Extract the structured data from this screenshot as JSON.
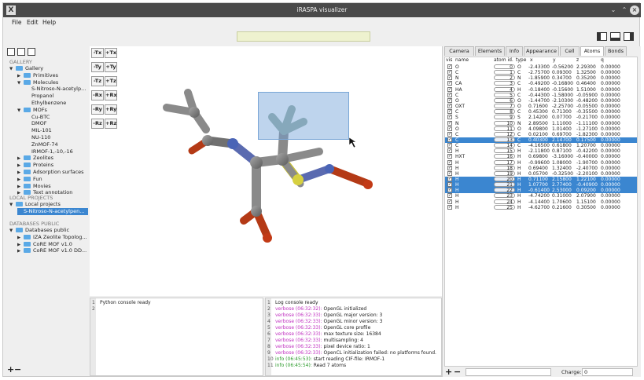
{
  "window": {
    "title": "iRASPA visualizer",
    "app_icon": "X"
  },
  "menu": {
    "file": "File",
    "edit": "Edit",
    "help": "Help"
  },
  "gallery": {
    "heading": "GALLERY",
    "items": [
      {
        "label": "Gallery",
        "depth": 0,
        "expanded": true,
        "folder": true
      },
      {
        "label": "Primitives",
        "depth": 1,
        "expanded": false,
        "folder": true
      },
      {
        "label": "Molecules",
        "depth": 1,
        "expanded": true,
        "folder": true
      },
      {
        "label": "S-Nitroso-N-acetylp...",
        "depth": 2,
        "folder": false
      },
      {
        "label": "Propanol",
        "depth": 2,
        "folder": false
      },
      {
        "label": "Ethylbenzene",
        "depth": 2,
        "folder": false
      },
      {
        "label": "MOFs",
        "depth": 1,
        "expanded": true,
        "folder": true
      },
      {
        "label": "Cu-BTC",
        "depth": 2,
        "folder": false
      },
      {
        "label": "DMOF",
        "depth": 2,
        "folder": false
      },
      {
        "label": "MIL-101",
        "depth": 2,
        "folder": false
      },
      {
        "label": "NU-110",
        "depth": 2,
        "folder": false
      },
      {
        "label": "ZnMOF-74",
        "depth": 2,
        "folder": false
      },
      {
        "label": "IRMOF-1,-10,-16",
        "depth": 2,
        "folder": false
      },
      {
        "label": "Zeolites",
        "depth": 1,
        "expanded": false,
        "folder": true
      },
      {
        "label": "Proteins",
        "depth": 1,
        "expanded": false,
        "folder": true
      },
      {
        "label": "Adsorption surfaces",
        "depth": 1,
        "expanded": false,
        "folder": true
      },
      {
        "label": "Fun",
        "depth": 1,
        "expanded": false,
        "folder": true
      },
      {
        "label": "Movies",
        "depth": 1,
        "expanded": false,
        "folder": true
      },
      {
        "label": "Text annotation",
        "depth": 1,
        "expanded": false,
        "folder": true
      }
    ]
  },
  "local_projects": {
    "heading": "LOCAL PROJECTS",
    "items": [
      {
        "label": "Local projects",
        "depth": 0,
        "expanded": true,
        "folder": true
      },
      {
        "label": "S-Nitroso-N-acetylpen...",
        "depth": 1,
        "folder": false,
        "selected": true
      }
    ]
  },
  "databases": {
    "heading": "DATABASES PUBLIC",
    "items": [
      {
        "label": "Databases public",
        "depth": 0,
        "expanded": true,
        "folder": true
      },
      {
        "label": "IZA Zeolite Topolog...",
        "depth": 1,
        "expanded": false,
        "folder": true
      },
      {
        "label": "CoRE MOF v1.0",
        "depth": 1,
        "expanded": false,
        "folder": true
      },
      {
        "label": "CoRE MOF v1.0 DD...",
        "depth": 1,
        "expanded": false,
        "folder": true
      }
    ]
  },
  "left_bottom": {
    "add": "+",
    "remove": "−"
  },
  "axis_buttons": [
    [
      "-Tx",
      "+Tx"
    ],
    [
      "-Ty",
      "+Ty"
    ],
    [
      "-Tz",
      "+Tz"
    ],
    [
      "-Rx",
      "+Rx"
    ],
    [
      "-Ry",
      "+Ry"
    ],
    [
      "-Rz",
      "+Rz"
    ]
  ],
  "python_console": {
    "lines": [
      {
        "num": "1",
        "text": "Python console ready"
      },
      {
        "num": "2",
        "text": ""
      }
    ]
  },
  "log_console": {
    "lines": [
      {
        "num": "1",
        "prefix": "",
        "text": "Log console ready",
        "kind": "plain"
      },
      {
        "num": "2",
        "prefix": "verbose (06:32:32):",
        "text": " OpenGL initialized",
        "kind": "verbose"
      },
      {
        "num": "3",
        "prefix": "verbose (06:32:33):",
        "text": " OpenGL major version: 3",
        "kind": "verbose"
      },
      {
        "num": "4",
        "prefix": "verbose (06:32:33):",
        "text": " OpenGL minor version: 3",
        "kind": "verbose"
      },
      {
        "num": "5",
        "prefix": "verbose (06:32:33):",
        "text": " OpenGL core profile",
        "kind": "verbose"
      },
      {
        "num": "6",
        "prefix": "verbose (06:32:33):",
        "text": " max texture size: 16384",
        "kind": "verbose"
      },
      {
        "num": "7",
        "prefix": "verbose (06:32:33):",
        "text": " multisampling: 4",
        "kind": "verbose"
      },
      {
        "num": "8",
        "prefix": "verbose (06:32:33):",
        "text": " pixel device ratio: 1",
        "kind": "verbose"
      },
      {
        "num": "9",
        "prefix": "verbose (06:32:33):",
        "text": " OpenCL initialization failed: no platforms found.",
        "kind": "verbose"
      },
      {
        "num": "10",
        "prefix": "info (06:45:53):",
        "text": " start reading CIF-file: IRMOF-1",
        "kind": "info"
      },
      {
        "num": "11",
        "prefix": "info (06:45:54):",
        "text": " Read 7 atoms",
        "kind": "info"
      }
    ]
  },
  "tabs": [
    "Camera",
    "Elements",
    "Info",
    "Appearance",
    "Cell",
    "Atoms",
    "Bonds"
  ],
  "active_tab": "Atoms",
  "atom_table": {
    "headers": {
      "vis": "vis",
      "name": "name",
      "atom_id": "atom id.",
      "type": "type",
      "x": "x",
      "y": "y",
      "z": "z",
      "q": "q"
    },
    "rows": [
      {
        "name": "O",
        "id": "0",
        "type": "O",
        "x": "-2.43300",
        "y": "-0.56200",
        "z": "2.29300",
        "q": "0.00000",
        "selected": false
      },
      {
        "name": "C",
        "id": "1",
        "type": "C",
        "x": "-2.75700",
        "y": "0.09300",
        "z": "1.32500",
        "q": "0.00000",
        "selected": false
      },
      {
        "name": "N",
        "id": "2",
        "type": "N",
        "x": "-1.85900",
        "y": "0.34700",
        "z": "0.35200",
        "q": "0.00000",
        "selected": false
      },
      {
        "name": "CA",
        "id": "3",
        "type": "C",
        "x": "-0.49200",
        "y": "-0.16800",
        "z": "0.46400",
        "q": "0.00000",
        "selected": false
      },
      {
        "name": "HA",
        "id": "4",
        "type": "H",
        "x": "-0.18400",
        "y": "-0.15600",
        "z": "1.51000",
        "q": "0.00000",
        "selected": false
      },
      {
        "name": "C",
        "id": "5",
        "type": "C",
        "x": "-0.44300",
        "y": "-1.58000",
        "z": "-0.05900",
        "q": "0.00000",
        "selected": false
      },
      {
        "name": "O",
        "id": "6",
        "type": "O",
        "x": "-1.44700",
        "y": "-2.10300",
        "z": "-0.48200",
        "q": "0.00000",
        "selected": false
      },
      {
        "name": "OXT",
        "id": "7",
        "type": "O",
        "x": "0.71600",
        "y": "-2.25700",
        "z": "-0.05500",
        "q": "0.00000",
        "selected": false
      },
      {
        "name": "C",
        "id": "8",
        "type": "C",
        "x": "0.45300",
        "y": "0.71300",
        "z": "-0.35500",
        "q": "0.00000",
        "selected": false
      },
      {
        "name": "S",
        "id": "9",
        "type": "S",
        "x": "2.14200",
        "y": "0.07700",
        "z": "-0.21700",
        "q": "0.00000",
        "selected": false
      },
      {
        "name": "N",
        "id": "10",
        "type": "N",
        "x": "2.89500",
        "y": "1.11000",
        "z": "-1.11100",
        "q": "0.00000",
        "selected": false
      },
      {
        "name": "O",
        "id": "11",
        "type": "O",
        "x": "4.09800",
        "y": "1.01400",
        "z": "-1.27100",
        "q": "0.00000",
        "selected": false
      },
      {
        "name": "C",
        "id": "12",
        "type": "C",
        "x": "0.02100",
        "y": "0.69700",
        "z": "-1.82300",
        "q": "0.00000",
        "selected": false
      },
      {
        "name": "C",
        "id": "13",
        "type": "C",
        "x": "0.40300",
        "y": "2.14700",
        "z": "0.17500",
        "q": "0.00000",
        "selected": true
      },
      {
        "name": "C",
        "id": "14",
        "type": "C",
        "x": "-4.16500",
        "y": "0.61800",
        "z": "1.20700",
        "q": "0.00000",
        "selected": false
      },
      {
        "name": "H",
        "id": "15",
        "type": "H",
        "x": "-2.11800",
        "y": "0.87100",
        "z": "-0.42200",
        "q": "0.00000",
        "selected": false
      },
      {
        "name": "HXT",
        "id": "16",
        "type": "H",
        "x": "0.69800",
        "y": "-3.16000",
        "z": "-0.40000",
        "q": "0.00000",
        "selected": false
      },
      {
        "name": "H",
        "id": "17",
        "type": "H",
        "x": "-0.99600",
        "y": "1.08000",
        "z": "-1.90700",
        "q": "0.00000",
        "selected": false
      },
      {
        "name": "H",
        "id": "18",
        "type": "H",
        "x": "0.69400",
        "y": "1.32400",
        "z": "-2.40700",
        "q": "0.00000",
        "selected": false
      },
      {
        "name": "H",
        "id": "19",
        "type": "H",
        "x": "0.05700",
        "y": "-0.32500",
        "z": "-2.20100",
        "q": "0.00000",
        "selected": false
      },
      {
        "name": "H",
        "id": "20",
        "type": "H",
        "x": "0.71100",
        "y": "2.15800",
        "z": "1.22100",
        "q": "0.00000",
        "selected": true
      },
      {
        "name": "H",
        "id": "21",
        "type": "H",
        "x": "1.07700",
        "y": "2.77400",
        "z": "-0.40900",
        "q": "0.00000",
        "selected": true
      },
      {
        "name": "H",
        "id": "22",
        "type": "H",
        "x": "-0.61400",
        "y": "2.53000",
        "z": "0.09200",
        "q": "0.00000",
        "selected": true
      },
      {
        "name": "H",
        "id": "23",
        "type": "H",
        "x": "-4.74200",
        "y": "0.31000",
        "z": "2.07900",
        "q": "0.00000",
        "selected": false
      },
      {
        "name": "H",
        "id": "24",
        "type": "H",
        "x": "-4.14400",
        "y": "1.70600",
        "z": "1.15100",
        "q": "0.00000",
        "selected": false
      },
      {
        "name": "H",
        "id": "25",
        "type": "H",
        "x": "-4.62700",
        "y": "0.21600",
        "z": "0.30500",
        "q": "0.00000",
        "selected": false
      }
    ]
  },
  "right_bottom": {
    "add": "+",
    "remove": "−",
    "charge_label": "Charge:",
    "charge_value": "0"
  },
  "colors": {
    "selection": "#3b86d0",
    "folder": "#5aa9e6",
    "verbose": "#c030c0",
    "info": "#2a9a2a",
    "status_field": "#eef2cf"
  }
}
